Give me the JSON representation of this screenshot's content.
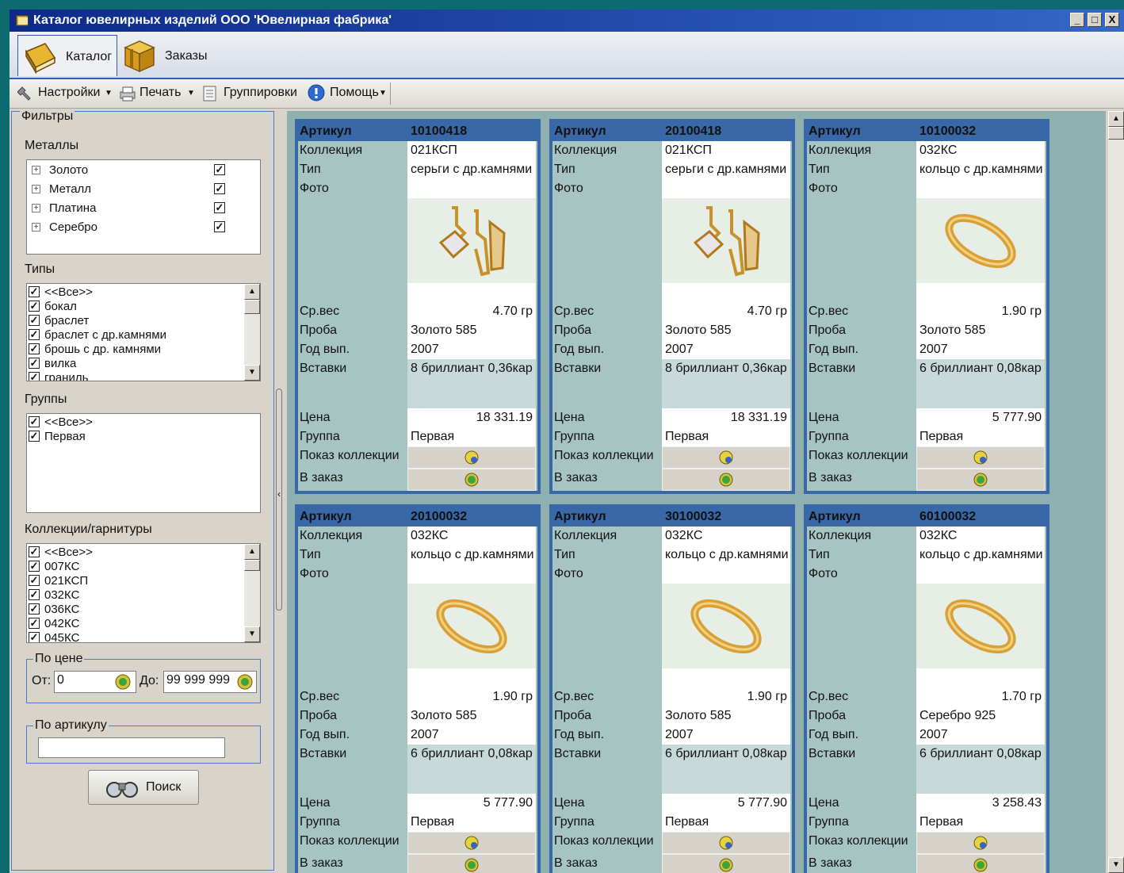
{
  "window": {
    "title": "Каталог ювелирных изделий ООО 'Ювелирная фабрика'",
    "controls": [
      "_",
      "□",
      "X"
    ]
  },
  "ribbon": {
    "tabs": [
      {
        "label": "Каталог",
        "icon": "book-icon",
        "active": true
      },
      {
        "label": "Заказы",
        "icon": "box-icon",
        "active": false
      }
    ]
  },
  "toolbar": {
    "items": [
      {
        "label": "Настройки",
        "icon": "settings-icon",
        "dropdown": true
      },
      {
        "label": "Печать",
        "icon": "printer-icon",
        "dropdown": true
      },
      {
        "label": "Группировки",
        "icon": "grouping-icon",
        "dropdown": false
      },
      {
        "label": "Помощь",
        "icon": "help-icon",
        "dropdown": true
      }
    ]
  },
  "filters": {
    "title": "Фильтры",
    "metals": {
      "label": "Металлы",
      "items": [
        {
          "label": "Золото",
          "checked": true
        },
        {
          "label": "Металл",
          "checked": true
        },
        {
          "label": "Платина",
          "checked": true
        },
        {
          "label": "Серебро",
          "checked": true
        }
      ]
    },
    "types": {
      "label": "Типы",
      "items": [
        {
          "label": "<<Все>>",
          "checked": true
        },
        {
          "label": "бокал",
          "checked": true
        },
        {
          "label": "браслет",
          "checked": true
        },
        {
          "label": "браслет с др.камнями",
          "checked": true
        },
        {
          "label": "брошь с др. камнями",
          "checked": true
        },
        {
          "label": "вилка",
          "checked": true
        },
        {
          "label": "граниль",
          "checked": true
        }
      ]
    },
    "groups": {
      "label": "Группы",
      "items": [
        {
          "label": "<<Все>>",
          "checked": true
        },
        {
          "label": "Первая",
          "checked": true
        }
      ]
    },
    "collections": {
      "label": "Коллекции/гарнитуры",
      "items": [
        {
          "label": "<<Все>>",
          "checked": true
        },
        {
          "label": "007КС",
          "checked": true
        },
        {
          "label": "021КСП",
          "checked": true
        },
        {
          "label": "032КС",
          "checked": true
        },
        {
          "label": "036КС",
          "checked": true
        },
        {
          "label": "042КС",
          "checked": true
        },
        {
          "label": "045КС",
          "checked": true
        }
      ]
    },
    "price": {
      "label": "По цене",
      "from_label": "От:",
      "from_value": "0",
      "to_label": "До:",
      "to_value": "99 999 999"
    },
    "article": {
      "label": "По артикулу",
      "value": ""
    },
    "search_label": "Поиск",
    "check_mark": "✓"
  },
  "card_labels": {
    "article": "Артикул",
    "collection": "Коллекция",
    "type": "Тип",
    "photo": "Фото",
    "weight": "Ср.вес",
    "probe": "Проба",
    "year": "Год вып.",
    "inserts": "Вставки",
    "price": "Цена",
    "group": "Группа",
    "show_collection": "Показ коллекции",
    "order": "В заказ"
  },
  "products": [
    {
      "article": "10100418",
      "collection": "021КСП",
      "type": "серьги с др.камнями",
      "photo": "earrings",
      "weight": "4.70 гр",
      "probe": "Золото 585",
      "year": "2007",
      "inserts": "8 бриллиант 0,36кар",
      "price": "18 331.19",
      "group": "Первая"
    },
    {
      "article": "20100418",
      "collection": "021КСП",
      "type": "серьги с др.камнями",
      "photo": "earrings",
      "weight": "4.70 гр",
      "probe": "Золото 585",
      "year": "2007",
      "inserts": "8 бриллиант 0,36кар",
      "price": "18 331.19",
      "group": "Первая"
    },
    {
      "article": "10100032",
      "collection": "032КС",
      "type": "кольцо с др.камнями",
      "photo": "ring",
      "weight": "1.90 гр",
      "probe": "Золото 585",
      "year": "2007",
      "inserts": "6 бриллиант 0,08кар",
      "price": "5 777.90",
      "group": "Первая"
    },
    {
      "article": "20100032",
      "collection": "032КС",
      "type": "кольцо с др.камнями",
      "photo": "ring",
      "weight": "1.90 гр",
      "probe": "Золото 585",
      "year": "2007",
      "inserts": "6 бриллиант 0,08кар",
      "price": "5 777.90",
      "group": "Первая"
    },
    {
      "article": "30100032",
      "collection": "032КС",
      "type": "кольцо с др.камнями",
      "photo": "ring",
      "weight": "1.90 гр",
      "probe": "Золото 585",
      "year": "2007",
      "inserts": "6 бриллиант 0,08кар",
      "price": "5 777.90",
      "group": "Первая"
    },
    {
      "article": "60100032",
      "collection": "032КС",
      "type": "кольцо с др.камнями",
      "photo": "ring",
      "weight": "1.70 гр",
      "probe": "Серебро 925",
      "year": "2007",
      "inserts": "6 бриллиант 0,08кар",
      "price": "3 258.43",
      "group": "Первая"
    }
  ],
  "colors": {
    "desktop": "#0d6b70",
    "title_bar": "#0c2a8a",
    "card_frame": "#3968a8",
    "card_label_bg": "#a6c4c2",
    "catalog_bg": "#8fb0ae"
  }
}
